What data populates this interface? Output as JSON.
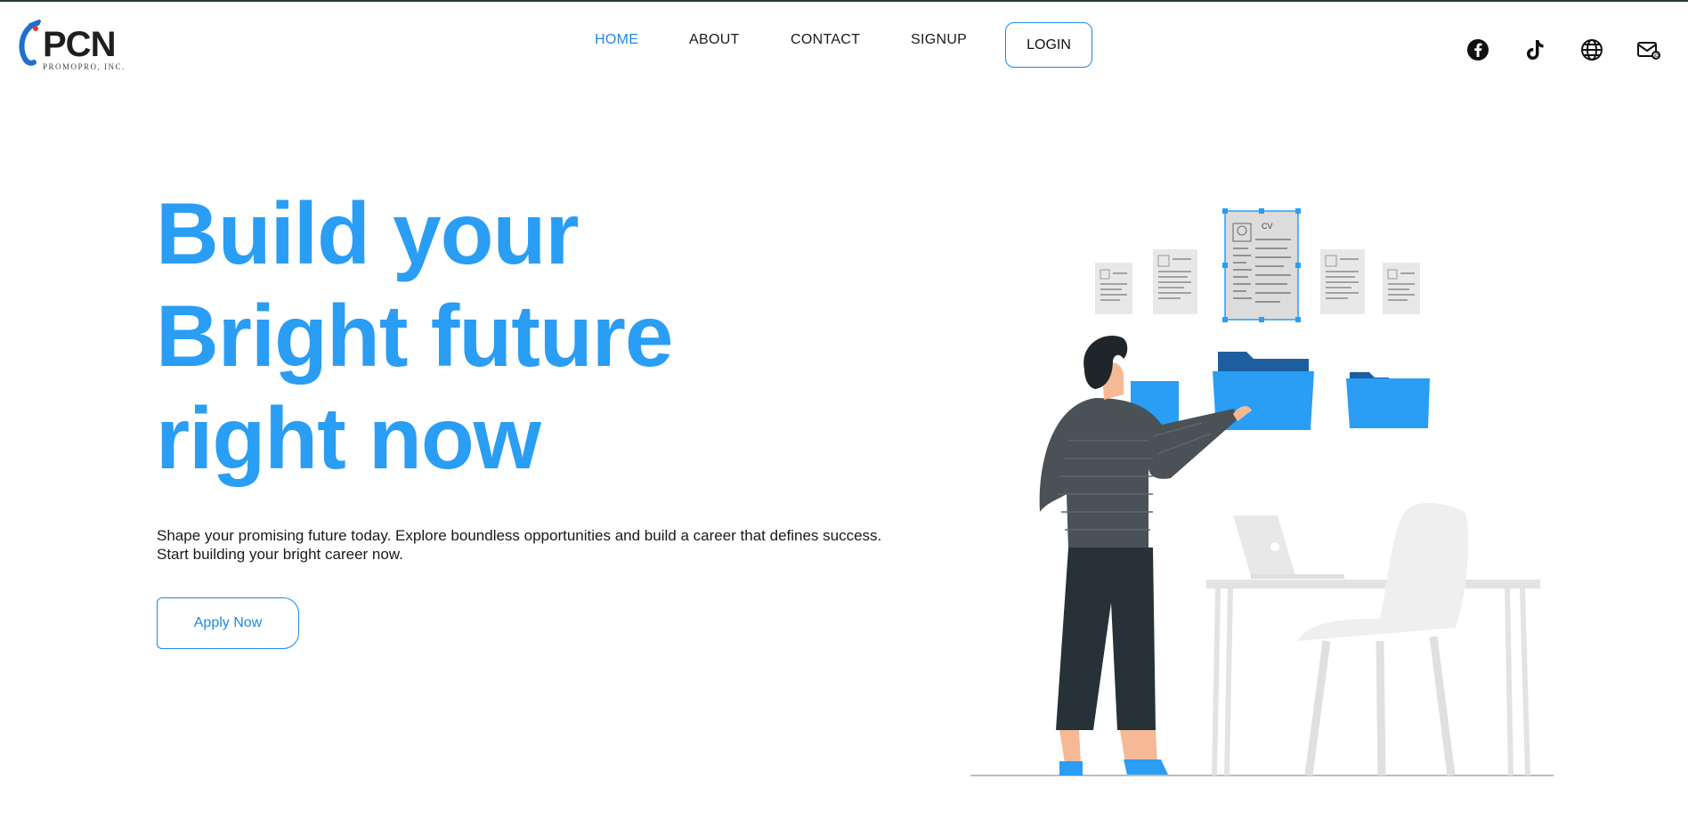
{
  "brand": {
    "name": "PCN",
    "tagline": "PROMOPRO, INC."
  },
  "nav": {
    "items": [
      {
        "label": "HOME",
        "active": true
      },
      {
        "label": "ABOUT",
        "active": false
      },
      {
        "label": "CONTACT",
        "active": false
      },
      {
        "label": "SIGNUP",
        "active": false
      }
    ],
    "login_label": "LOGIN"
  },
  "social": [
    "facebook-icon",
    "tiktok-icon",
    "globe-icon",
    "mail-icon"
  ],
  "hero": {
    "title_lines": [
      "Build your",
      "Bright future",
      "right now"
    ],
    "description": "Shape your promising future today. Explore boundless opportunities and build a career that defines success. Start building your bright career now.",
    "cta_label": "Apply Now"
  },
  "illustration": {
    "cv_label": "CV"
  },
  "colors": {
    "accent": "#2a9df4",
    "link_active": "#1e88e5",
    "text": "#1a1a1a"
  }
}
